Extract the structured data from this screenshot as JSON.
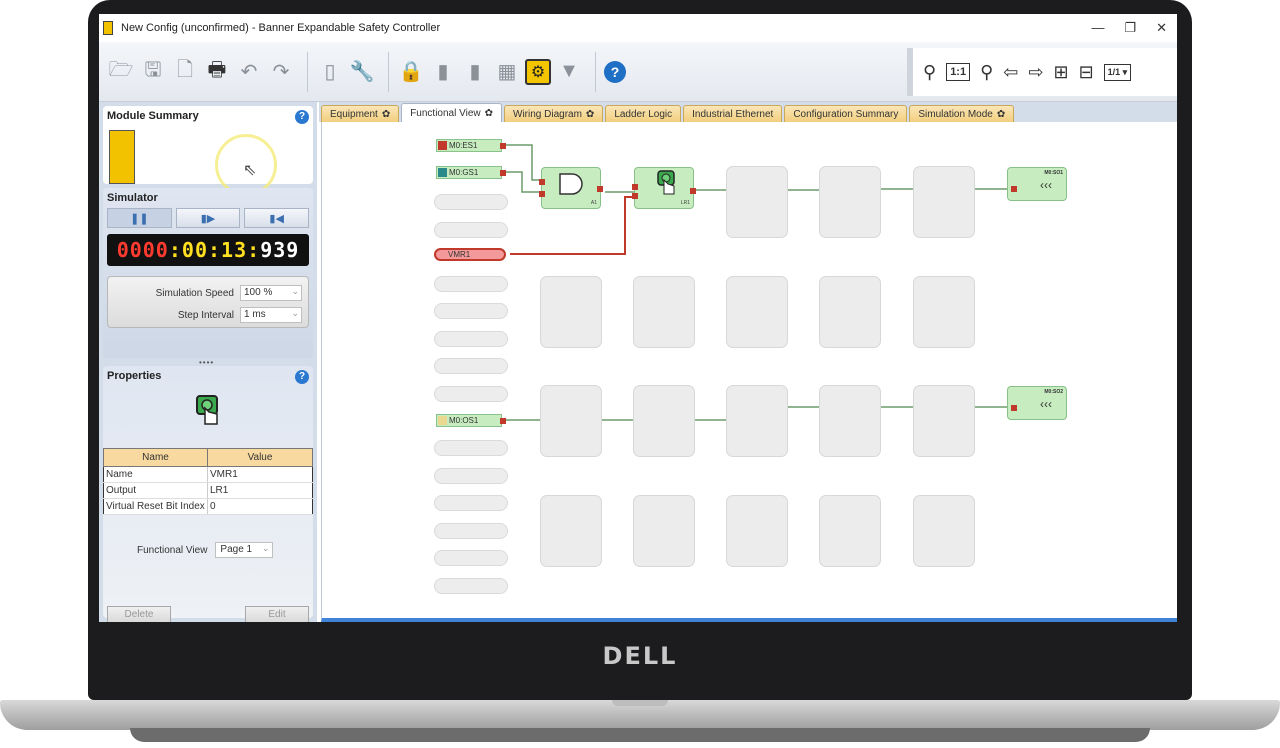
{
  "window": {
    "title": "New Config (unconfirmed) - Banner Expandable Safety Controller",
    "min": "—",
    "max": "❐",
    "close": "✕"
  },
  "toolbar": {
    "icons": [
      "open-folder-icon",
      "save-icon",
      "new-file-icon",
      "print-icon",
      "undo-icon",
      "redo-icon",
      "module-icon",
      "wrench-icon",
      "lock-icon",
      "device-icon",
      "device2-icon",
      "network-icon",
      "gear-icon",
      "plug-icon",
      "help-icon"
    ],
    "zoom_11": "1:1",
    "page_indicator": "1/1 ▾",
    "help": "?"
  },
  "module_summary": {
    "title": "Module Summary",
    "help": "?"
  },
  "simulator": {
    "title": "Simulator",
    "clock": {
      "hours": "0000",
      "sep1": ":",
      "minutes": "00",
      "sep2": ":",
      "seconds": "13",
      "sep3": ":",
      "millis": "939"
    },
    "speed_label": "Simulation Speed",
    "speed_value": "100 %",
    "step_label": "Step Interval",
    "step_value": "1 ms",
    "grip": "••••"
  },
  "properties": {
    "title": "Properties",
    "help": "?",
    "col_name": "Name",
    "col_value": "Value",
    "rows": [
      {
        "name": "Name",
        "value": "VMR1"
      },
      {
        "name": "Output",
        "value": "LR1"
      },
      {
        "name": "Virtual Reset Bit Index",
        "value": "0"
      }
    ],
    "fv_label": "Functional View",
    "fv_value": "Page 1",
    "delete": "Delete",
    "edit": "Edit"
  },
  "tabs": [
    {
      "label": "Equipment",
      "gear": "✿"
    },
    {
      "label": "Functional View",
      "gear": "✿"
    },
    {
      "label": "Wiring Diagram",
      "gear": "✿"
    },
    {
      "label": "Ladder Logic",
      "gear": ""
    },
    {
      "label": "Industrial Ethernet",
      "gear": ""
    },
    {
      "label": "Configuration Summary",
      "gear": ""
    },
    {
      "label": "Simulation Mode",
      "gear": "✿"
    }
  ],
  "canvas": {
    "inputs": {
      "es1": "M0:ES1",
      "gs1": "M0:GS1",
      "vmr1": "VMR1",
      "os1": "M0:OS1"
    },
    "blocks": {
      "and": "A1",
      "reset": "LR1"
    },
    "outputs": {
      "so1": "M0:SO1",
      "so2": "M0:SO2"
    }
  },
  "laptop_logo": "DELL",
  "colors": {
    "wire_green": "#6b9b6b",
    "wire_red": "#c0392b",
    "accent_blue": "#3f84d6",
    "gear_yellow": "#f3c400"
  }
}
